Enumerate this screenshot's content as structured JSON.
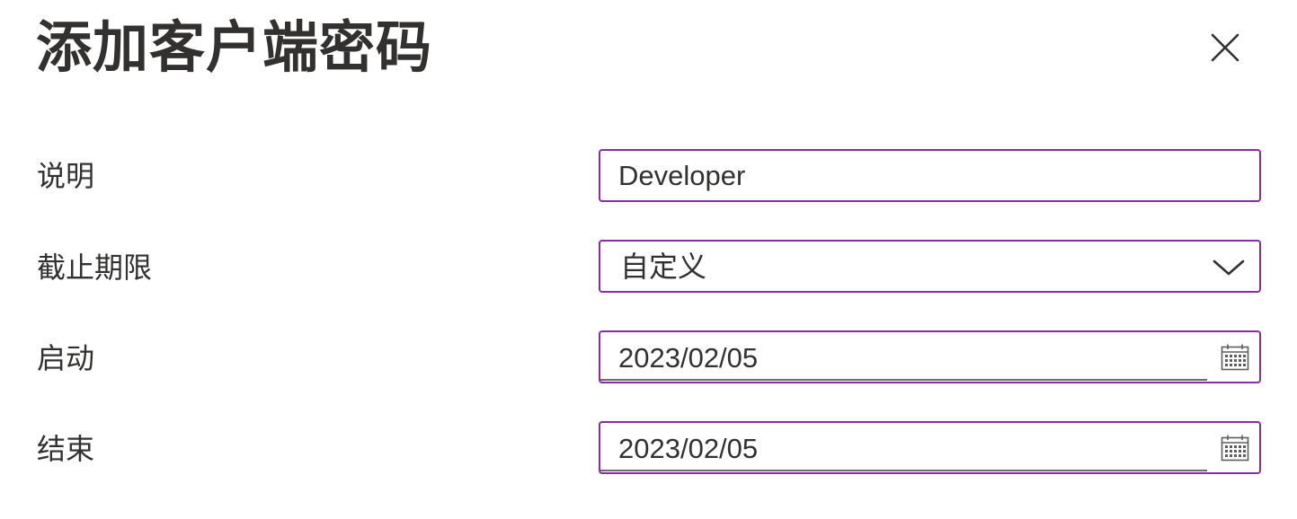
{
  "dialog": {
    "title": "添加客户端密码"
  },
  "form": {
    "description": {
      "label": "说明",
      "value": "Developer"
    },
    "expiry": {
      "label": "截止期限",
      "selected": "自定义"
    },
    "start": {
      "label": "启动",
      "value": "2023/02/05"
    },
    "end": {
      "label": "结束",
      "value": "2023/02/05"
    }
  },
  "icons": {
    "close": "close-icon",
    "dropdown": "chevron-down-icon",
    "calendar": "calendar-icon"
  },
  "colors": {
    "accent_border": "#8a2da5",
    "text": "#323130"
  }
}
